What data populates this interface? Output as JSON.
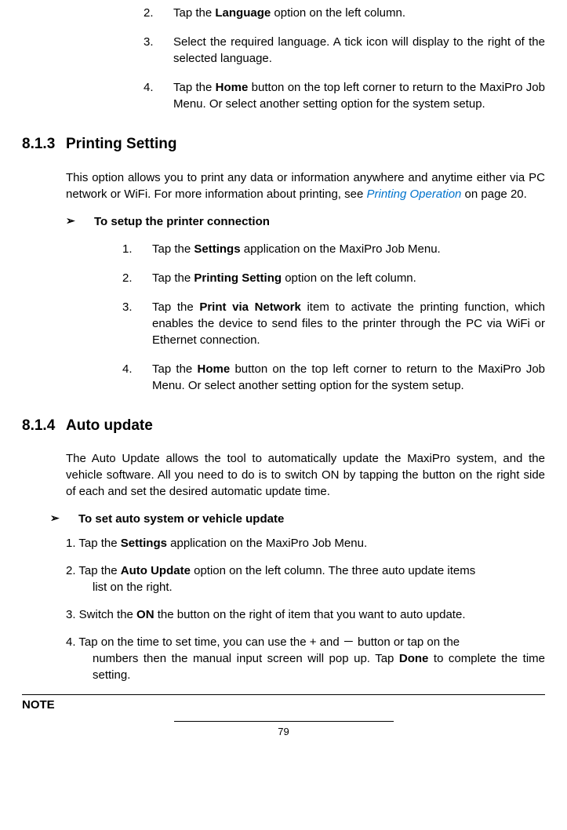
{
  "continued_list": [
    {
      "num": "2.",
      "text_pre": "Tap the ",
      "bold": "Language",
      "text_post": " option on the left column."
    },
    {
      "num": "3.",
      "text": "Select the required language. A tick icon will display to the right of the selected language."
    },
    {
      "num": "4.",
      "text_pre": "Tap the ",
      "bold": "Home",
      "text_post": " button on the top left corner to return to the MaxiPro Job Menu. Or select another setting option for the system setup."
    }
  ],
  "section_813": {
    "num": "8.1.3",
    "title": "Printing Setting",
    "intro_1": "This option allows you to print any data or information anywhere and anytime either via PC network or WiFi. For more information about printing, see ",
    "intro_link": "Printing Operation",
    "intro_2": " on page 20.",
    "howto_bullet": "➢",
    "howto_title": "To setup the printer connection",
    "steps": [
      {
        "num": "1.",
        "pre": "Tap the ",
        "bold": "Settings",
        "post": " application on the MaxiPro Job Menu."
      },
      {
        "num": "2.",
        "pre": "Tap the ",
        "bold": "Printing Setting",
        "post": " option on the left column."
      },
      {
        "num": "3.",
        "pre": "Tap the ",
        "bold": "Print via Network",
        "post": " item to activate the printing function, which enables the device to send files to the printer through the PC via WiFi or Ethernet connection."
      },
      {
        "num": "4.",
        "pre": "Tap the ",
        "bold": "Home",
        "post": " button on the top left corner to return to the MaxiPro Job Menu. Or select another setting option for the system setup."
      }
    ]
  },
  "section_814": {
    "num": "8.1.4",
    "title": "Auto update",
    "intro": "The Auto Update allows the tool to automatically update the MaxiPro system, and the vehicle software. All you need to do is to switch ON by tapping the button on the right side of each and set the desired automatic update time.",
    "howto_bullet": "➢",
    "howto_title": "To set auto system or vehicle update",
    "steps": [
      {
        "line1": "1. Tap the ",
        "bold1": "Settings",
        "post1": " application on the MaxiPro Job Menu."
      },
      {
        "line1": "2. Tap the ",
        "bold1": "Auto Update",
        "post1": " option on the left column. The three auto update items ",
        "cont": "list on the right."
      },
      {
        "line1": "3. Switch the ",
        "bold1": "ON",
        "post1": " the button on the right of item that you want to auto update."
      },
      {
        "line1": "4. Tap on the time to set time, you can use the + and － button or tap on the ",
        "cont": "numbers then the manual input screen will pop up. Tap ",
        "bold2": "Done",
        "post2": " to complete the time setting."
      }
    ]
  },
  "note_label": "NOTE",
  "page_number": "79"
}
